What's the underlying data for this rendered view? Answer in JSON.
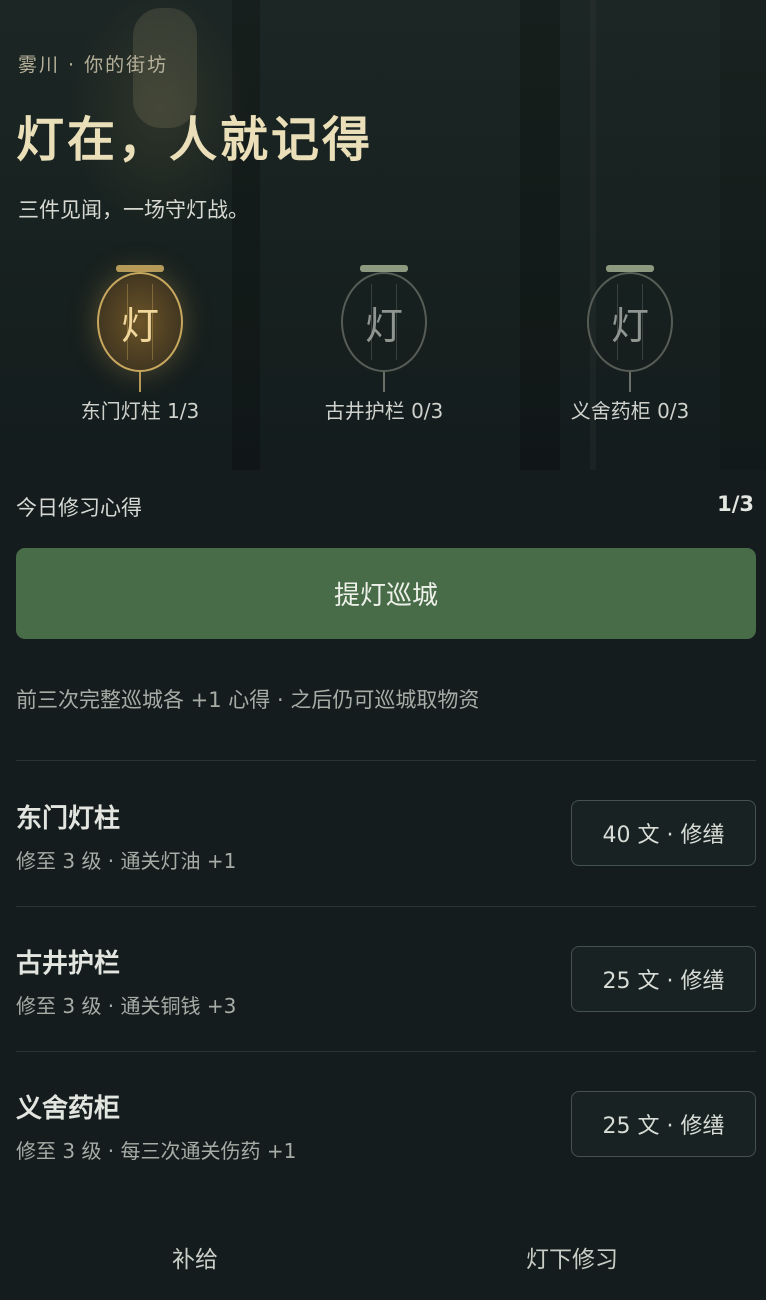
{
  "header": {
    "breadcrumb": "雾川 · 你的街坊",
    "title": "灯在，人就记得",
    "subtitle": "三件见闻，一场守灯战。"
  },
  "lanterns": [
    {
      "char": "灯",
      "label": "东门灯柱 1/3",
      "lit": true
    },
    {
      "char": "灯",
      "label": "古井护栏 0/3",
      "lit": false
    },
    {
      "char": "灯",
      "label": "义舍药柜 0/3",
      "lit": false
    }
  ],
  "progress": {
    "label": "今日修习心得",
    "count": "1/3"
  },
  "patrol": {
    "button_label": "提灯巡城",
    "hint": "前三次完整巡城各 +1 心得 · 之后仍可巡城取物资"
  },
  "items": [
    {
      "title": "东门灯柱",
      "desc": "修至 3 级 · 通关灯油 +1",
      "button": "40 文 · 修缮"
    },
    {
      "title": "古井护栏",
      "desc": "修至 3 级 · 通关铜钱 +3",
      "button": "25 文 · 修缮"
    },
    {
      "title": "义舍药柜",
      "desc": "修至 3 级 · 每三次通关伤药 +1",
      "button": "25 文 · 修缮"
    }
  ],
  "bottom_tabs": [
    "补给",
    "灯下修习"
  ],
  "colors": {
    "background": "#141c1d",
    "accent_green": "#486b48",
    "lantern_gold": "#c8a85e",
    "title_gold": "#eadfb9"
  }
}
